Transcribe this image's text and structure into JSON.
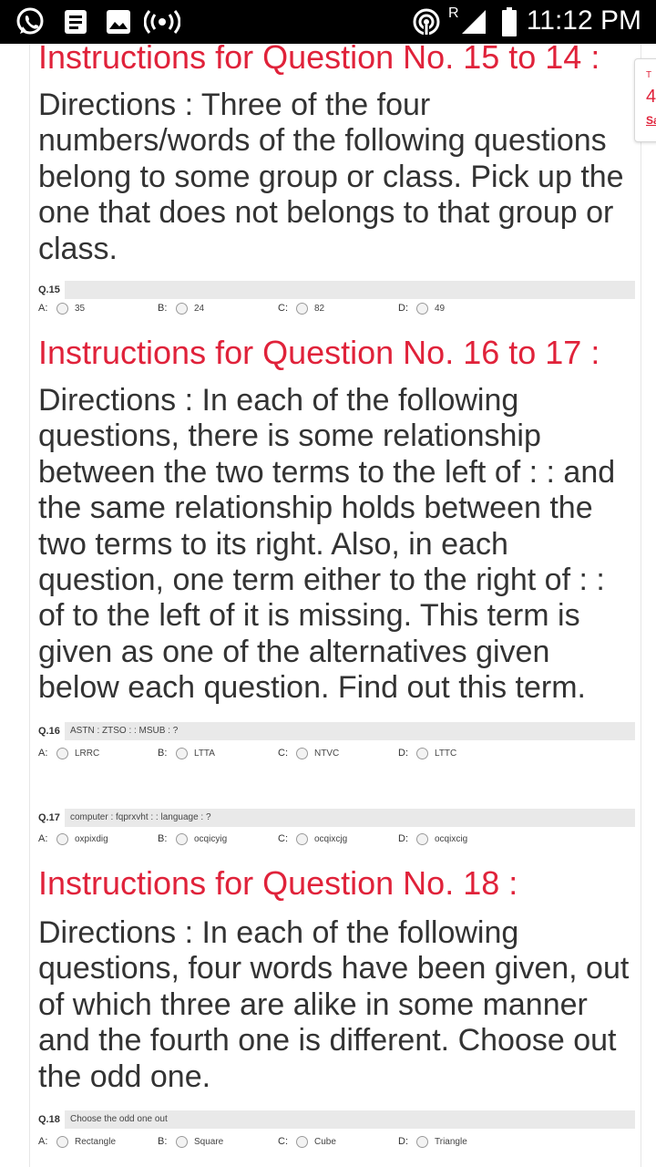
{
  "status_bar": {
    "time": "11:12 PM",
    "roaming": "R",
    "icons": [
      "whatsapp-icon",
      "document-icon",
      "image-icon",
      "broadcast-icon",
      "hotspot-icon",
      "signal-icon",
      "battery-icon"
    ]
  },
  "side_tab": {
    "top": "T",
    "number": "4",
    "save": "Sav"
  },
  "sections": [
    {
      "title": "Instructions for Question No. 15 to 14 :",
      "directions": "Directions : Three of the four numbers/words of the following questions belong to some group or class. Pick up the one that does not belongs to that group or class."
    },
    {
      "title": "Instructions for Question No. 16 to 17 :",
      "directions": "Directions : In each of the following questions, there is some relationship between the two terms to the left of : : and the same relationship holds between the two terms to its right. Also, in each question, one term either to the right of : : of to the left of it is missing. This term is given as one of the alternatives given below each question. Find out this term."
    },
    {
      "title": "Instructions for Question No. 18 :",
      "directions": "Directions : In each of the following questions, four words have been given, out of which three are alike in some manner and the fourth one is different. Choose out the odd one."
    }
  ],
  "questions": [
    {
      "number": "Q.15",
      "text": "",
      "options": [
        {
          "letter": "A:",
          "value": "35"
        },
        {
          "letter": "B:",
          "value": "24"
        },
        {
          "letter": "C:",
          "value": "82"
        },
        {
          "letter": "D:",
          "value": "49"
        }
      ]
    },
    {
      "number": "Q.16",
      "text": "ASTN : ZTSO : : MSUB : ?",
      "options": [
        {
          "letter": "A:",
          "value": "LRRC"
        },
        {
          "letter": "B:",
          "value": "LTTA"
        },
        {
          "letter": "C:",
          "value": "NTVC"
        },
        {
          "letter": "D:",
          "value": "LTTC"
        }
      ]
    },
    {
      "number": "Q.17",
      "text": "computer : fqprxvht : : language : ?",
      "options": [
        {
          "letter": "A:",
          "value": "oxpixdig"
        },
        {
          "letter": "B:",
          "value": "ocqicyig"
        },
        {
          "letter": "C:",
          "value": "ocqixcjg"
        },
        {
          "letter": "D:",
          "value": "ocqixcig"
        }
      ]
    },
    {
      "number": "Q.18",
      "text": "Choose the odd one out",
      "options": [
        {
          "letter": "A:",
          "value": "Rectangle"
        },
        {
          "letter": "B:",
          "value": "Square"
        },
        {
          "letter": "C:",
          "value": "Cube"
        },
        {
          "letter": "D:",
          "value": "Triangle"
        }
      ]
    }
  ],
  "colors": {
    "accent": "#e0223a",
    "question_bar": "#e9e9e9",
    "status_bar": "#000000"
  }
}
